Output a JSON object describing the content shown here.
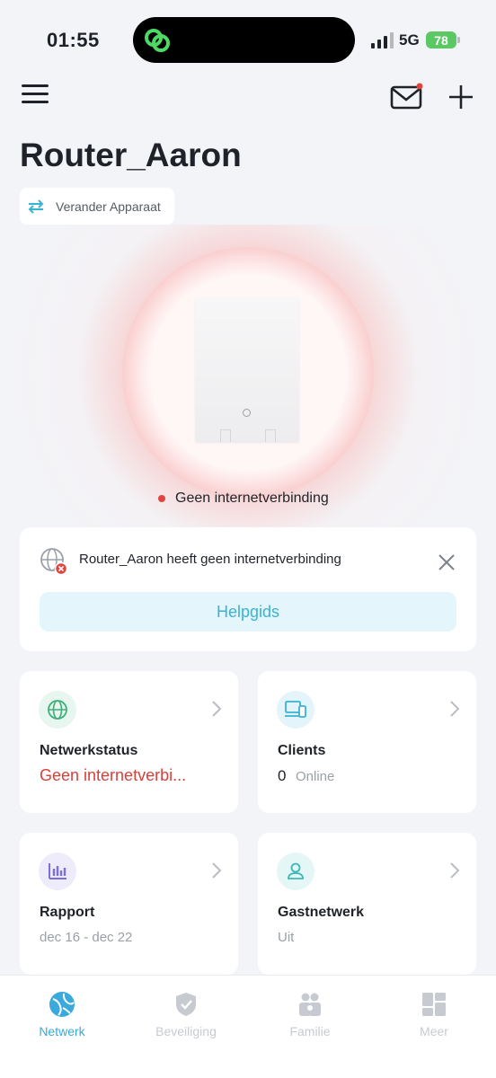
{
  "status_bar": {
    "time": "01:55",
    "network": "5G",
    "battery": "78"
  },
  "header": {
    "title": "Router_Aaron",
    "switch_device_label": "Verander Apparaat"
  },
  "hero": {
    "status_text": "Geen internetverbinding",
    "status_color": "#e0463f"
  },
  "alert": {
    "message": "Router_Aaron heeft geen internetverbinding",
    "help_button": "Helpgids"
  },
  "tiles": {
    "network_status": {
      "title": "Netwerkstatus",
      "value": "Geen internetverbi..."
    },
    "clients": {
      "title": "Clients",
      "count": "0",
      "label": "Online"
    },
    "report": {
      "title": "Rapport",
      "range": "dec 16 - dec 22"
    },
    "guest": {
      "title": "Gastnetwerk",
      "state": "Uit"
    }
  },
  "nav": {
    "items": [
      {
        "label": "Netwerk",
        "icon": "globe-icon",
        "active": true
      },
      {
        "label": "Beveiliging",
        "icon": "shield-icon",
        "active": false
      },
      {
        "label": "Familie",
        "icon": "family-icon",
        "active": false
      },
      {
        "label": "Meer",
        "icon": "grid-icon",
        "active": false
      }
    ]
  },
  "colors": {
    "accent": "#38a9d6",
    "error": "#d9403a",
    "battery": "#5cc864"
  }
}
